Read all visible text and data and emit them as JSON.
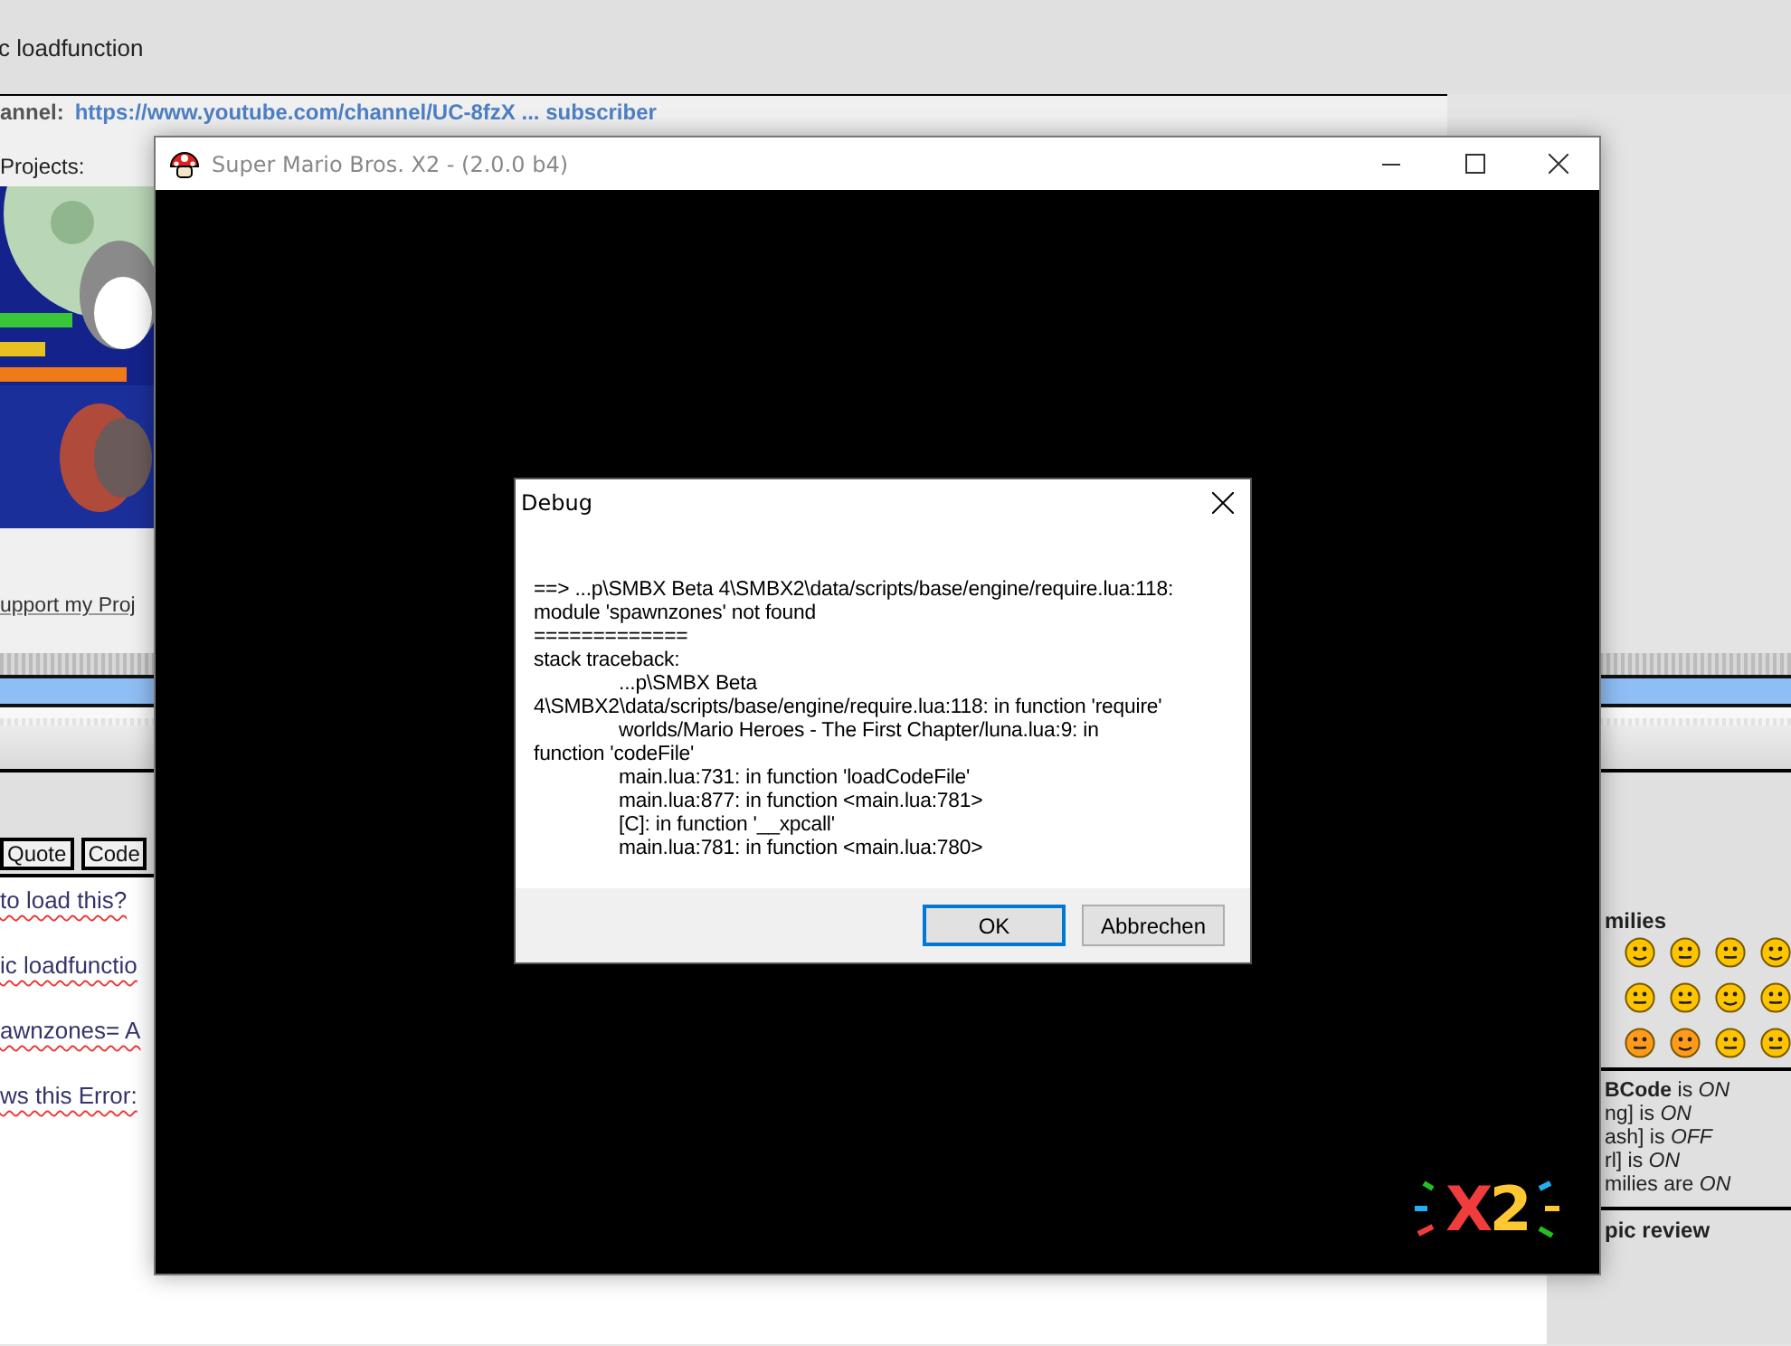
{
  "forum": {
    "topic_title": "c loadfunction",
    "channel_label": "annel:",
    "channel_link": "https://www.youtube.com/channel/UC-8fzX ... subscriber",
    "projects_label": "Projects:",
    "support_link": "upport my Proj",
    "editor_buttons": [
      "Quote",
      "Code"
    ],
    "message_lines": [
      "to load this?",
      "ic loadfunctio",
      "awnzones= A",
      "ws this Error:"
    ],
    "smilies_title": "milies",
    "options": [
      "**BCode** is *ON*",
      "ng] is *ON*",
      "ash] is *OFF*",
      "rl] is *ON*",
      "milies are *ON*"
    ],
    "topic_review": "pic review"
  },
  "game_window": {
    "title": "Super Mario Bros. X2 - (2.0.0 b4)",
    "logo": [
      {
        "text": "X",
        "color": "#f03c3c"
      },
      {
        "text": "2",
        "color": "#ffc832"
      }
    ]
  },
  "dialog": {
    "title": "Debug",
    "lines": [
      {
        "text": "==> ...p\\SMBX Beta 4\\SMBX2\\data/scripts/base/engine/require.lua:118:",
        "indented": false
      },
      {
        "text": "module 'spawnzones' not found",
        "indented": false
      },
      {
        "text": "=============",
        "indented": false
      },
      {
        "text": "stack traceback:",
        "indented": false
      },
      {
        "text": "...p\\SMBX Beta",
        "indented": true
      },
      {
        "text": "4\\SMBX2\\data/scripts/base/engine/require.lua:118: in function 'require'",
        "indented": false
      },
      {
        "text": "worlds/Mario Heroes - The First Chapter/luna.lua:9: in",
        "indented": true
      },
      {
        "text": "function 'codeFile'",
        "indented": false
      },
      {
        "text": "main.lua:731: in function 'loadCodeFile'",
        "indented": true
      },
      {
        "text": "main.lua:877: in function <main.lua:781>",
        "indented": true
      },
      {
        "text": "[C]: in function '__xpcall'",
        "indented": true
      },
      {
        "text": "main.lua:781: in function <main.lua:780>",
        "indented": true
      }
    ],
    "buttons": [
      {
        "label": "OK",
        "default": true
      },
      {
        "label": "Abbrechen",
        "default": false
      }
    ]
  }
}
